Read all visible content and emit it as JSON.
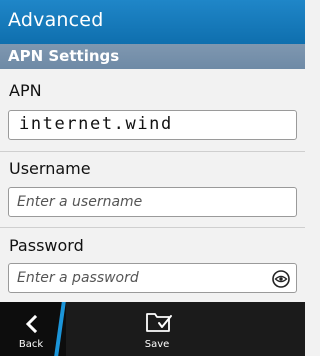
{
  "header": {
    "title": "Advanced"
  },
  "section": {
    "title": "APN Settings"
  },
  "fields": {
    "apn": {
      "label": "APN",
      "value": "internet.wind"
    },
    "username": {
      "label": "Username",
      "placeholder": "Enter a username"
    },
    "password": {
      "label": "Password",
      "placeholder": "Enter a password"
    }
  },
  "actionbar": {
    "back_label": "Back",
    "save_label": "Save"
  },
  "icons": {
    "back": "chevron-left-icon",
    "save": "save-icon",
    "show_password": "eye-icon"
  },
  "colors": {
    "header": "#1479bb",
    "section_header": "#7690ab",
    "accent": "#1b95d9",
    "actionbar": "#1b1b1b"
  }
}
